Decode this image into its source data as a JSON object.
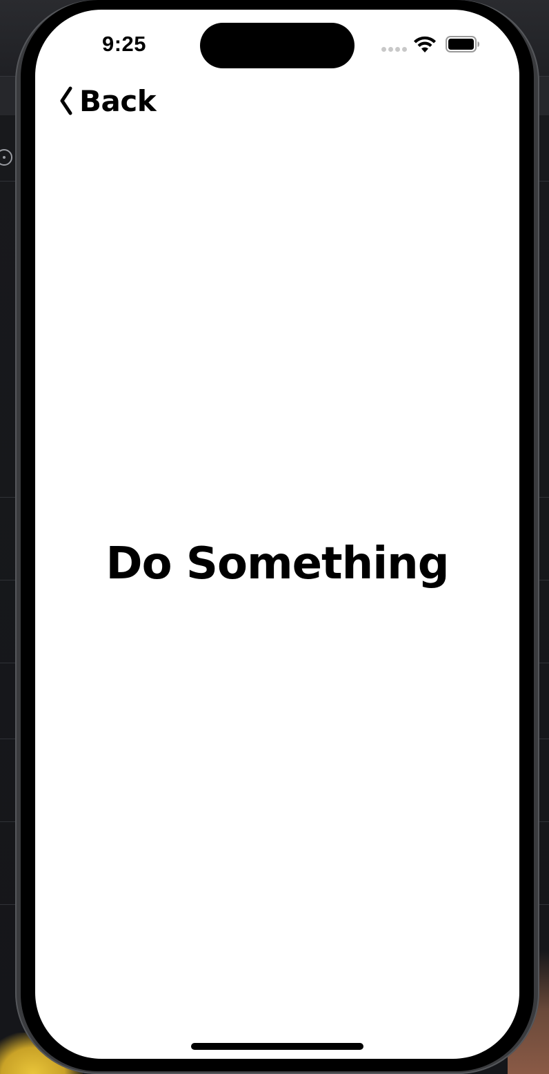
{
  "status_bar": {
    "time": "9:25",
    "icons": [
      "signal-dots-icon",
      "wifi-icon",
      "battery-icon"
    ]
  },
  "nav": {
    "back_label": "Back",
    "back_icon": "chevron-left-icon"
  },
  "main": {
    "title": "Do Something"
  },
  "colors": {
    "screen_background": "#ffffff",
    "text": "#000000",
    "device_frame": "#000000"
  }
}
